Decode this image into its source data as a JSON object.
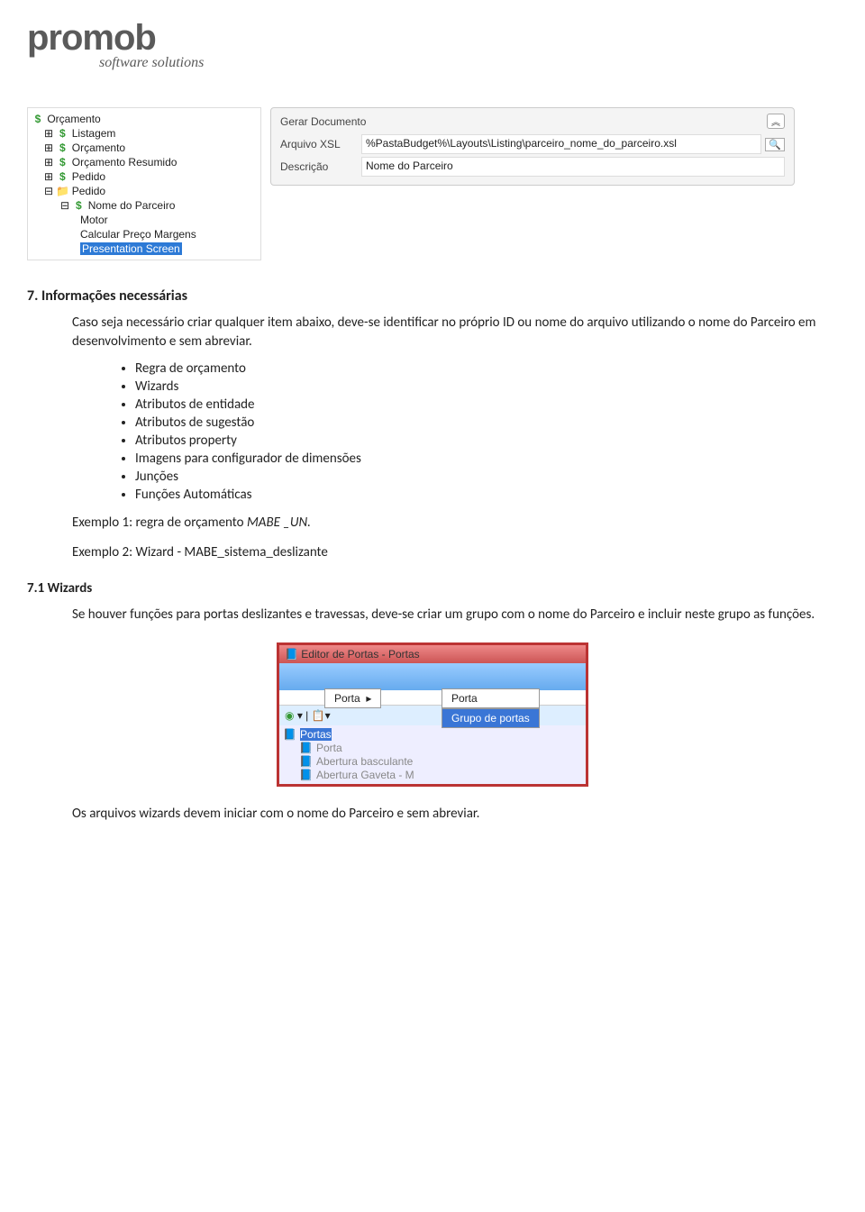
{
  "logo": {
    "main": "promob",
    "sub": "software solutions"
  },
  "tree": {
    "root": "Orçamento",
    "items": [
      "Listagem",
      "Orçamento",
      "Orçamento Resumido",
      "Pedido"
    ],
    "pedido2": "Pedido",
    "partner": "Nome do Parceiro",
    "sub": [
      "Motor",
      "Calcular Preço Margens"
    ],
    "selected": "Presentation Screen"
  },
  "panel": {
    "title": "Gerar Documento",
    "row1_label": "Arquivo XSL",
    "row1_value": "%PastaBudget%\\Layouts\\Listing\\parceiro_nome_do_parceiro.xsl",
    "row2_label": "Descrição",
    "row2_value": "Nome do Parceiro"
  },
  "s7": {
    "heading": "7. Informações necessárias",
    "p1": "Caso seja necessário criar qualquer item abaixo, deve-se identificar no próprio ID ou nome do arquivo utilizando o nome do Parceiro em desenvolvimento e sem abreviar.",
    "bullets": [
      "Regra de orçamento",
      "Wizards",
      "Atributos de entidade",
      "Atributos de sugestão",
      "Atributos property",
      "Imagens para configurador de dimensões",
      "Junções",
      "Funções Automáticas"
    ],
    "ex1a": "Exemplo 1: regra de orçamento ",
    "ex1b": "MABE _UN.",
    "ex2": "Exemplo 2: Wizard - MABE_sistema_deslizante"
  },
  "s71": {
    "heading": "7.1 Wizards",
    "p1": "Se houver funções para portas deslizantes e travessas, deve-se criar um grupo com o nome do Parceiro e incluir neste grupo as funções.",
    "p2": "Os arquivos wizards devem iniciar com o nome do Parceiro e sem abreviar."
  },
  "fig2": {
    "title": "Editor de Portas - Portas",
    "node_sel": "Portas",
    "menu1": "Porta",
    "row2": "Abertura basculante",
    "row3": "Abertura Gaveta - M",
    "pop1": "Porta",
    "pop2": "Grupo de portas"
  }
}
